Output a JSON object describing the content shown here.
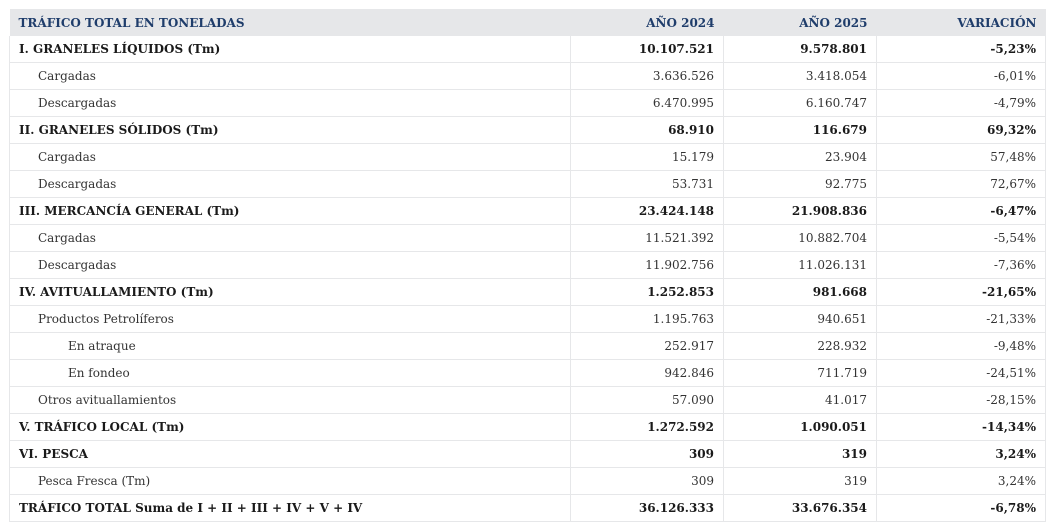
{
  "table": {
    "headers": [
      "TRÁFICO TOTAL EN TONELADAS",
      "AÑO 2024",
      "AÑO 2025",
      "VARIACIÓN"
    ],
    "rows": [
      {
        "level": 0,
        "cells": [
          "I. GRANELES LÍQUIDOS (Tm)",
          "10.107.521",
          "9.578.801",
          "-5,23%"
        ]
      },
      {
        "level": 1,
        "cells": [
          "Cargadas",
          "3.636.526",
          "3.418.054",
          "-6,01%"
        ]
      },
      {
        "level": 1,
        "cells": [
          "Descargadas",
          "6.470.995",
          "6.160.747",
          "-4,79%"
        ]
      },
      {
        "level": 0,
        "cells": [
          "II. GRANELES SÓLIDOS (Tm)",
          "68.910",
          "116.679",
          "69,32%"
        ]
      },
      {
        "level": 1,
        "cells": [
          "Cargadas",
          "15.179",
          "23.904",
          "57,48%"
        ]
      },
      {
        "level": 1,
        "cells": [
          "Descargadas",
          "53.731",
          "92.775",
          "72,67%"
        ]
      },
      {
        "level": 0,
        "cells": [
          "III. MERCANCÍA GENERAL (Tm)",
          "23.424.148",
          "21.908.836",
          "-6,47%"
        ]
      },
      {
        "level": 1,
        "cells": [
          "Cargadas",
          "11.521.392",
          "10.882.704",
          "-5,54%"
        ]
      },
      {
        "level": 1,
        "cells": [
          "Descargadas",
          "11.902.756",
          "11.026.131",
          "-7,36%"
        ]
      },
      {
        "level": 0,
        "cells": [
          "IV. AVITUALLAMIENTO (Tm)",
          "1.252.853",
          "981.668",
          "-21,65%"
        ]
      },
      {
        "level": 1,
        "cells": [
          "Productos Petrolíferos",
          "1.195.763",
          "940.651",
          "-21,33%"
        ]
      },
      {
        "level": 2,
        "cells": [
          "En atraque",
          "252.917",
          "228.932",
          "-9,48%"
        ]
      },
      {
        "level": 2,
        "cells": [
          "En fondeo",
          "942.846",
          "711.719",
          "-24,51%"
        ]
      },
      {
        "level": 1,
        "cells": [
          "Otros avituallamientos",
          "57.090",
          "41.017",
          "-28,15%"
        ]
      },
      {
        "level": 0,
        "cells": [
          "V. TRÁFICO LOCAL (Tm)",
          "1.272.592",
          "1.090.051",
          "-14,34%"
        ]
      },
      {
        "level": 0,
        "cells": [
          "VI. PESCA",
          "309",
          "319",
          "3,24%"
        ]
      },
      {
        "level": 1,
        "cells": [
          "Pesca Fresca (Tm)",
          "309",
          "319",
          "3,24%"
        ]
      },
      {
        "level": 0,
        "cells": [
          "TRÁFICO TOTAL Suma de I + II + III + IV + V + IV",
          "36.126.333",
          "33.676.354",
          "-6,78%"
        ]
      }
    ]
  },
  "colors": {
    "header_bg": "#e6e7e9",
    "header_text": "#1f3d6b",
    "border": "#e6e7e9"
  }
}
